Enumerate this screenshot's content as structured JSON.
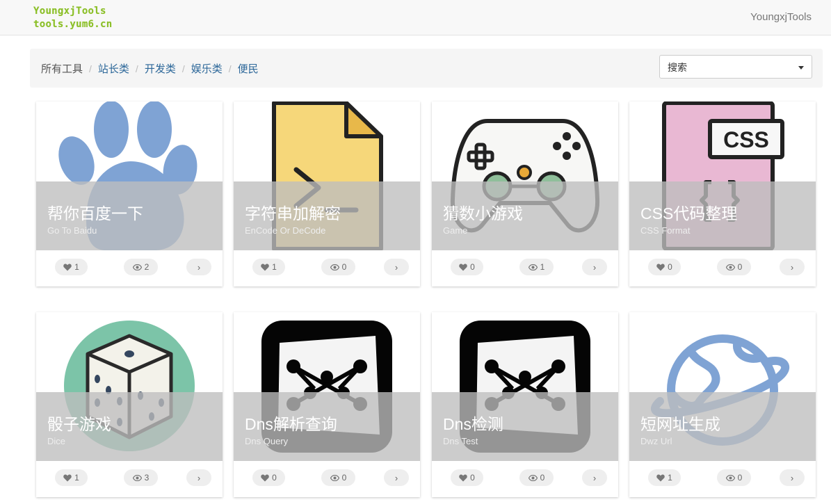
{
  "navbar": {
    "logo_line1": "YoungxjTools",
    "logo_line2": "tools.yum6.cn",
    "right_link": "YoungxjTools"
  },
  "breadcrumb": {
    "items": [
      "所有工具",
      "站长类",
      "开发类",
      "娱乐类",
      "便民"
    ]
  },
  "search": {
    "label": "搜索"
  },
  "cards": [
    {
      "title": "帮你百度一下",
      "subtitle": "Go To Baidu",
      "likes": "1",
      "views": "2",
      "go": "›",
      "icon": "paw-icon"
    },
    {
      "title": "字符串加解密",
      "subtitle": "EnCode Or DeCode",
      "likes": "1",
      "views": "0",
      "go": "›",
      "icon": "script-file-icon"
    },
    {
      "title": "猜数小游戏",
      "subtitle": "Game",
      "likes": "0",
      "views": "1",
      "go": "›",
      "icon": "gamepad-icon"
    },
    {
      "title": "CSS代码整理",
      "subtitle": "CSS Format",
      "likes": "0",
      "views": "0",
      "go": "›",
      "icon": "css-file-icon"
    },
    {
      "title": "骰子游戏",
      "subtitle": "Dice",
      "likes": "1",
      "views": "3",
      "go": "›",
      "icon": "dice-icon"
    },
    {
      "title": "Dns解析查询",
      "subtitle": "Dns Query",
      "likes": "0",
      "views": "0",
      "go": "›",
      "icon": "network-icon"
    },
    {
      "title": "Dns检测",
      "subtitle": "Dns Test",
      "likes": "0",
      "views": "0",
      "go": "›",
      "icon": "network-icon"
    },
    {
      "title": "短网址生成",
      "subtitle": "Dwz Url",
      "likes": "1",
      "views": "0",
      "go": "›",
      "icon": "planet-icon"
    }
  ]
}
